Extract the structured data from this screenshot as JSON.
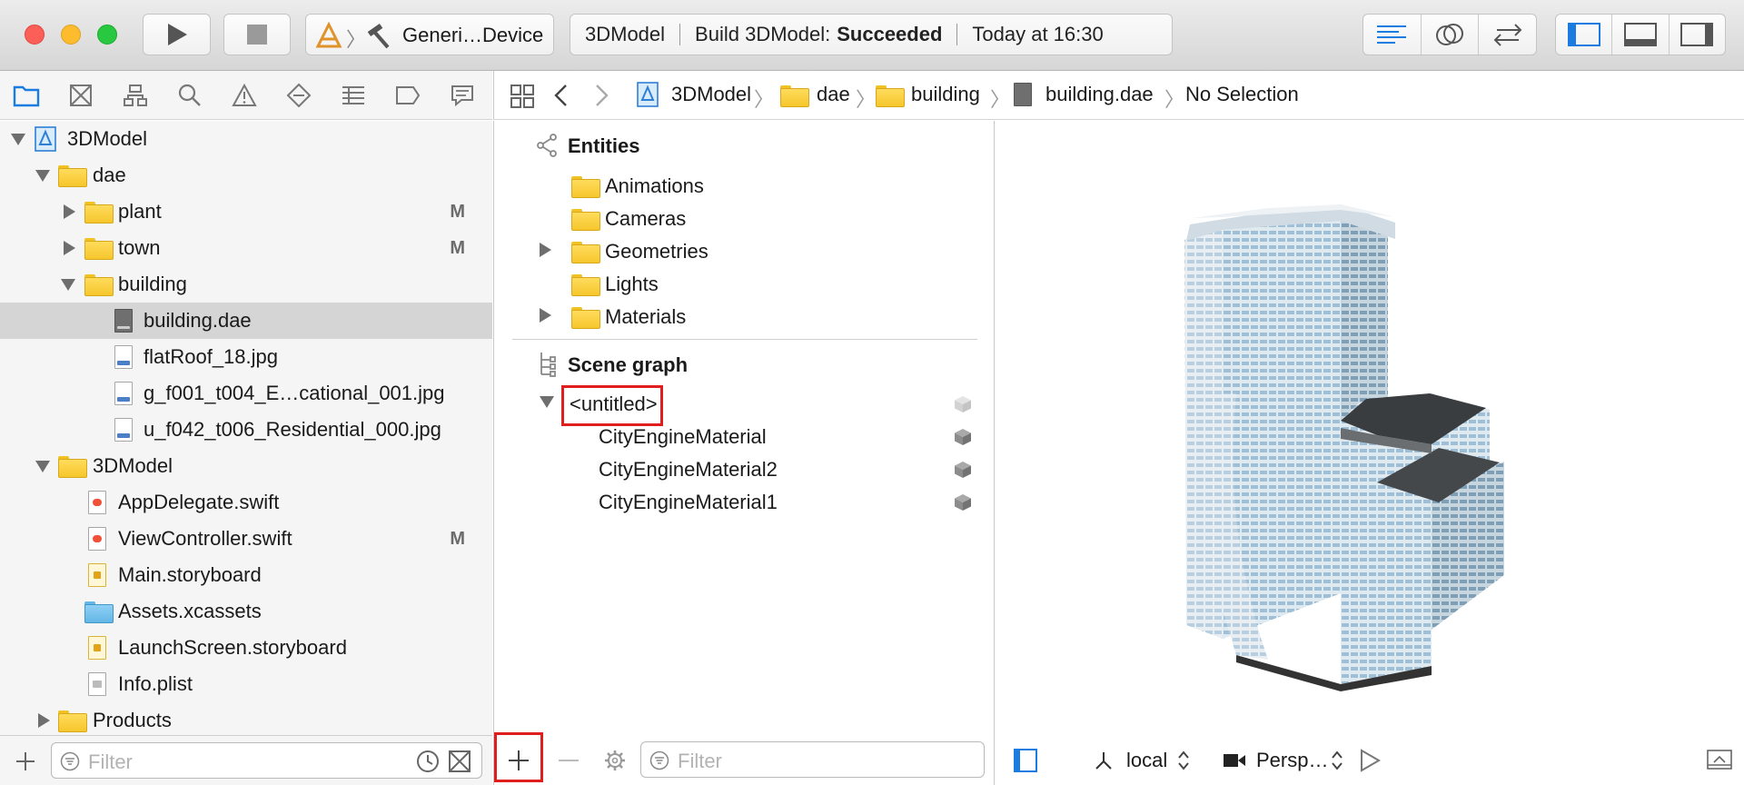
{
  "toolbar": {
    "scheme": "Generi…Device",
    "status": {
      "project": "3DModel",
      "build_prefix": "Build 3DModel:",
      "build_result": "Succeeded",
      "time": "Today at 16:30"
    }
  },
  "navigator": {
    "items": [
      {
        "label": "3DModel"
      },
      {
        "label": "dae"
      },
      {
        "label": "plant",
        "mark": "M"
      },
      {
        "label": "town",
        "mark": "M"
      },
      {
        "label": "building"
      },
      {
        "label": "building.dae"
      },
      {
        "label": "flatRoof_18.jpg"
      },
      {
        "label": "g_f001_t004_E…cational_001.jpg"
      },
      {
        "label": "u_f042_t006_Residential_000.jpg"
      },
      {
        "label": "3DModel"
      },
      {
        "label": "AppDelegate.swift"
      },
      {
        "label": "ViewController.swift",
        "mark": "M"
      },
      {
        "label": "Main.storyboard"
      },
      {
        "label": "Assets.xcassets"
      },
      {
        "label": "LaunchScreen.storyboard"
      },
      {
        "label": "Info.plist"
      },
      {
        "label": "Products"
      }
    ],
    "filter_placeholder": "Filter"
  },
  "breadcrumb": [
    "3DModel",
    "dae",
    "building",
    "building.dae",
    "No Selection"
  ],
  "scene": {
    "entities_title": "Entities",
    "entities": [
      "Animations",
      "Cameras",
      "Geometries",
      "Lights",
      "Materials"
    ],
    "scene_graph_title": "Scene graph",
    "root_node": "<untitled>",
    "children": [
      "CityEngineMaterial",
      "CityEngineMaterial2",
      "CityEngineMaterial1"
    ],
    "filter_placeholder": "Filter"
  },
  "viewport": {
    "coord_space": "local",
    "camera": "Persp…"
  },
  "colors": {
    "selection": "#d5d5d5",
    "highlight_box": "#e01e1e",
    "accent": "#1a7be0"
  }
}
